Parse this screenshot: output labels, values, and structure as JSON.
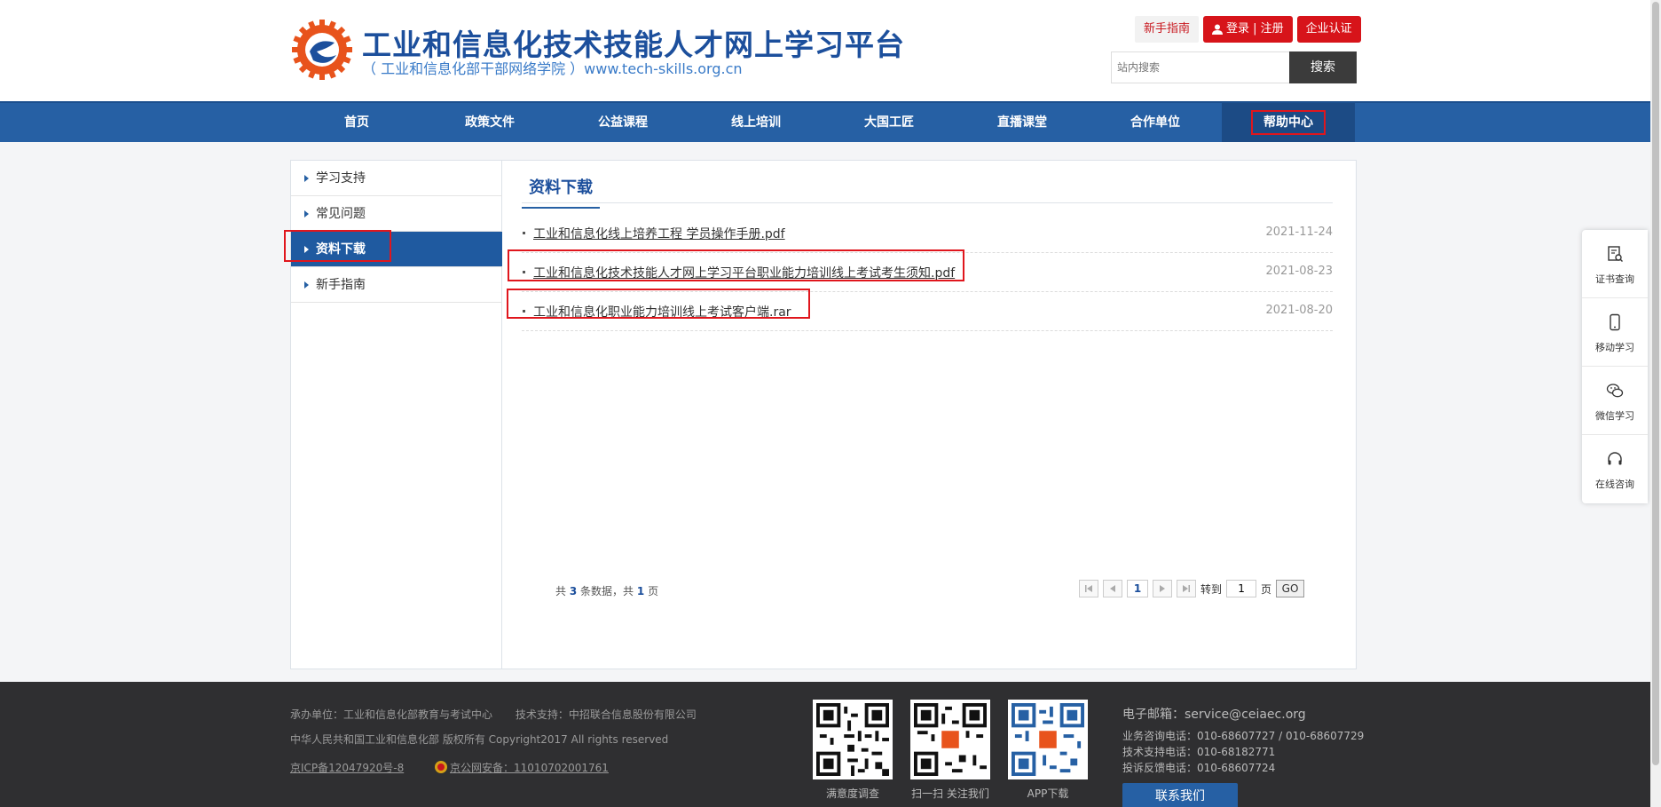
{
  "header": {
    "title": "工业和信息化技术技能人才网上学习平台",
    "subtitle": "（ 工业和信息化部干部网络学院 ）www.tech-skills.org.cn",
    "guide_label": "新手指南",
    "login_label": "登录 | 注册",
    "enterprise_label": "企业认证",
    "search_placeholder": "站内搜索",
    "search_button": "搜索"
  },
  "nav": {
    "items": [
      "首页",
      "政策文件",
      "公益课程",
      "线上培训",
      "大国工匠",
      "直播课堂",
      "合作单位",
      "帮助中心"
    ],
    "active": "帮助中心"
  },
  "sidebar": {
    "items": [
      "学习支持",
      "常见问题",
      "资料下载",
      "新手指南"
    ],
    "active": "资料下载"
  },
  "main": {
    "title": "资料下载",
    "files": [
      {
        "name": "工业和信息化线上培养工程 学员操作手册.pdf",
        "date": "2021-11-24"
      },
      {
        "name": "工业和信息化技术技能人才网上学习平台职业能力培训线上考试考生须知.pdf",
        "date": "2021-08-23"
      },
      {
        "name": "工业和信息化职业能力培训线上考试客户端.rar",
        "date": "2021-08-20"
      }
    ]
  },
  "pagination": {
    "info_prefix": "共",
    "total_records": "3",
    "info_mid": "条数据，共",
    "total_pages": "1",
    "info_suffix": "页",
    "current_page": "1",
    "goto_label": "转到",
    "goto_value": "1",
    "page_unit": "页",
    "go_label": "GO"
  },
  "footer": {
    "organizer": "承办单位：工业和信息化部教育与考试中心",
    "tech_support": "技术支持：中招联合信息股份有限公司",
    "copyright": "中华人民共和国工业和信息化部 版权所有 Copyright2017 All rights reserved",
    "icp": "京ICP备12047920号-8",
    "police": "京公网安备：11010702001761",
    "qr_labels": [
      "满意度调查",
      "扫一扫 关注我们",
      "APP下载"
    ],
    "email": "电子邮箱：service@ceiaec.org",
    "phone_business": "业务咨询电话：010-68607727 / 010-68607729",
    "phone_tech": "技术支持电话：010-68182771",
    "phone_complaint": "投诉反馈电话：010-68607724",
    "contact_button": "联系我们"
  },
  "float_panel": {
    "items": [
      "证书查询",
      "移动学习",
      "微信学习",
      "在线咨询"
    ]
  },
  "colors": {
    "primary": "#2660a4",
    "accent_red": "#d7141a",
    "footer_bg": "#2f2f31"
  }
}
